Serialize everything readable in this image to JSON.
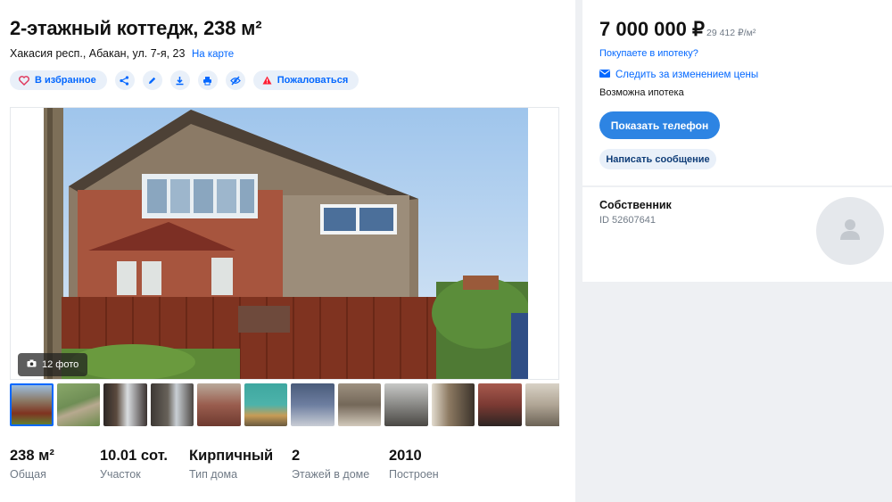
{
  "listing": {
    "title": "2-этажный коттедж, 238 м²",
    "address": "Хакасия респ., Абакан, ул. 7-я, 23",
    "map_link": "На карте"
  },
  "actions": {
    "favorite_label": "В избранное",
    "complain_label": "Пожаловаться"
  },
  "gallery": {
    "photo_count": "12 фото",
    "thumbnail_count": 12,
    "active_thumbnail": 1
  },
  "stats": [
    {
      "value": "238 м²",
      "label": "Общая"
    },
    {
      "value": "10.01 сот.",
      "label": "Участок"
    },
    {
      "value": "Кирпичный",
      "label": "Тип дома"
    },
    {
      "value": "2",
      "label": "Этажей в доме"
    },
    {
      "value": "2010",
      "label": "Построен"
    }
  ],
  "price": {
    "value": "7 000 000 ₽",
    "per_meter": "29 412 ₽/м²",
    "mortgage_link": "Покупаете в ипотеку?",
    "follow_price": "Следить за изменением цены",
    "mortgage_text": "Возможна ипотека",
    "show_phone": "Показать телефон",
    "write_message": "Написать сообщение"
  },
  "owner": {
    "title": "Собственник",
    "id": "ID 52607641"
  },
  "colors": {
    "accent": "#0468ff",
    "button_primary": "#2d84e3",
    "pill_bg": "#e9f0f9",
    "danger": "#ff1f34"
  },
  "icons": [
    "heart-icon",
    "share-icon",
    "pencil-icon",
    "download-icon",
    "print-icon",
    "hide-icon",
    "warning-icon",
    "camera-icon",
    "mail-icon",
    "user-icon"
  ]
}
